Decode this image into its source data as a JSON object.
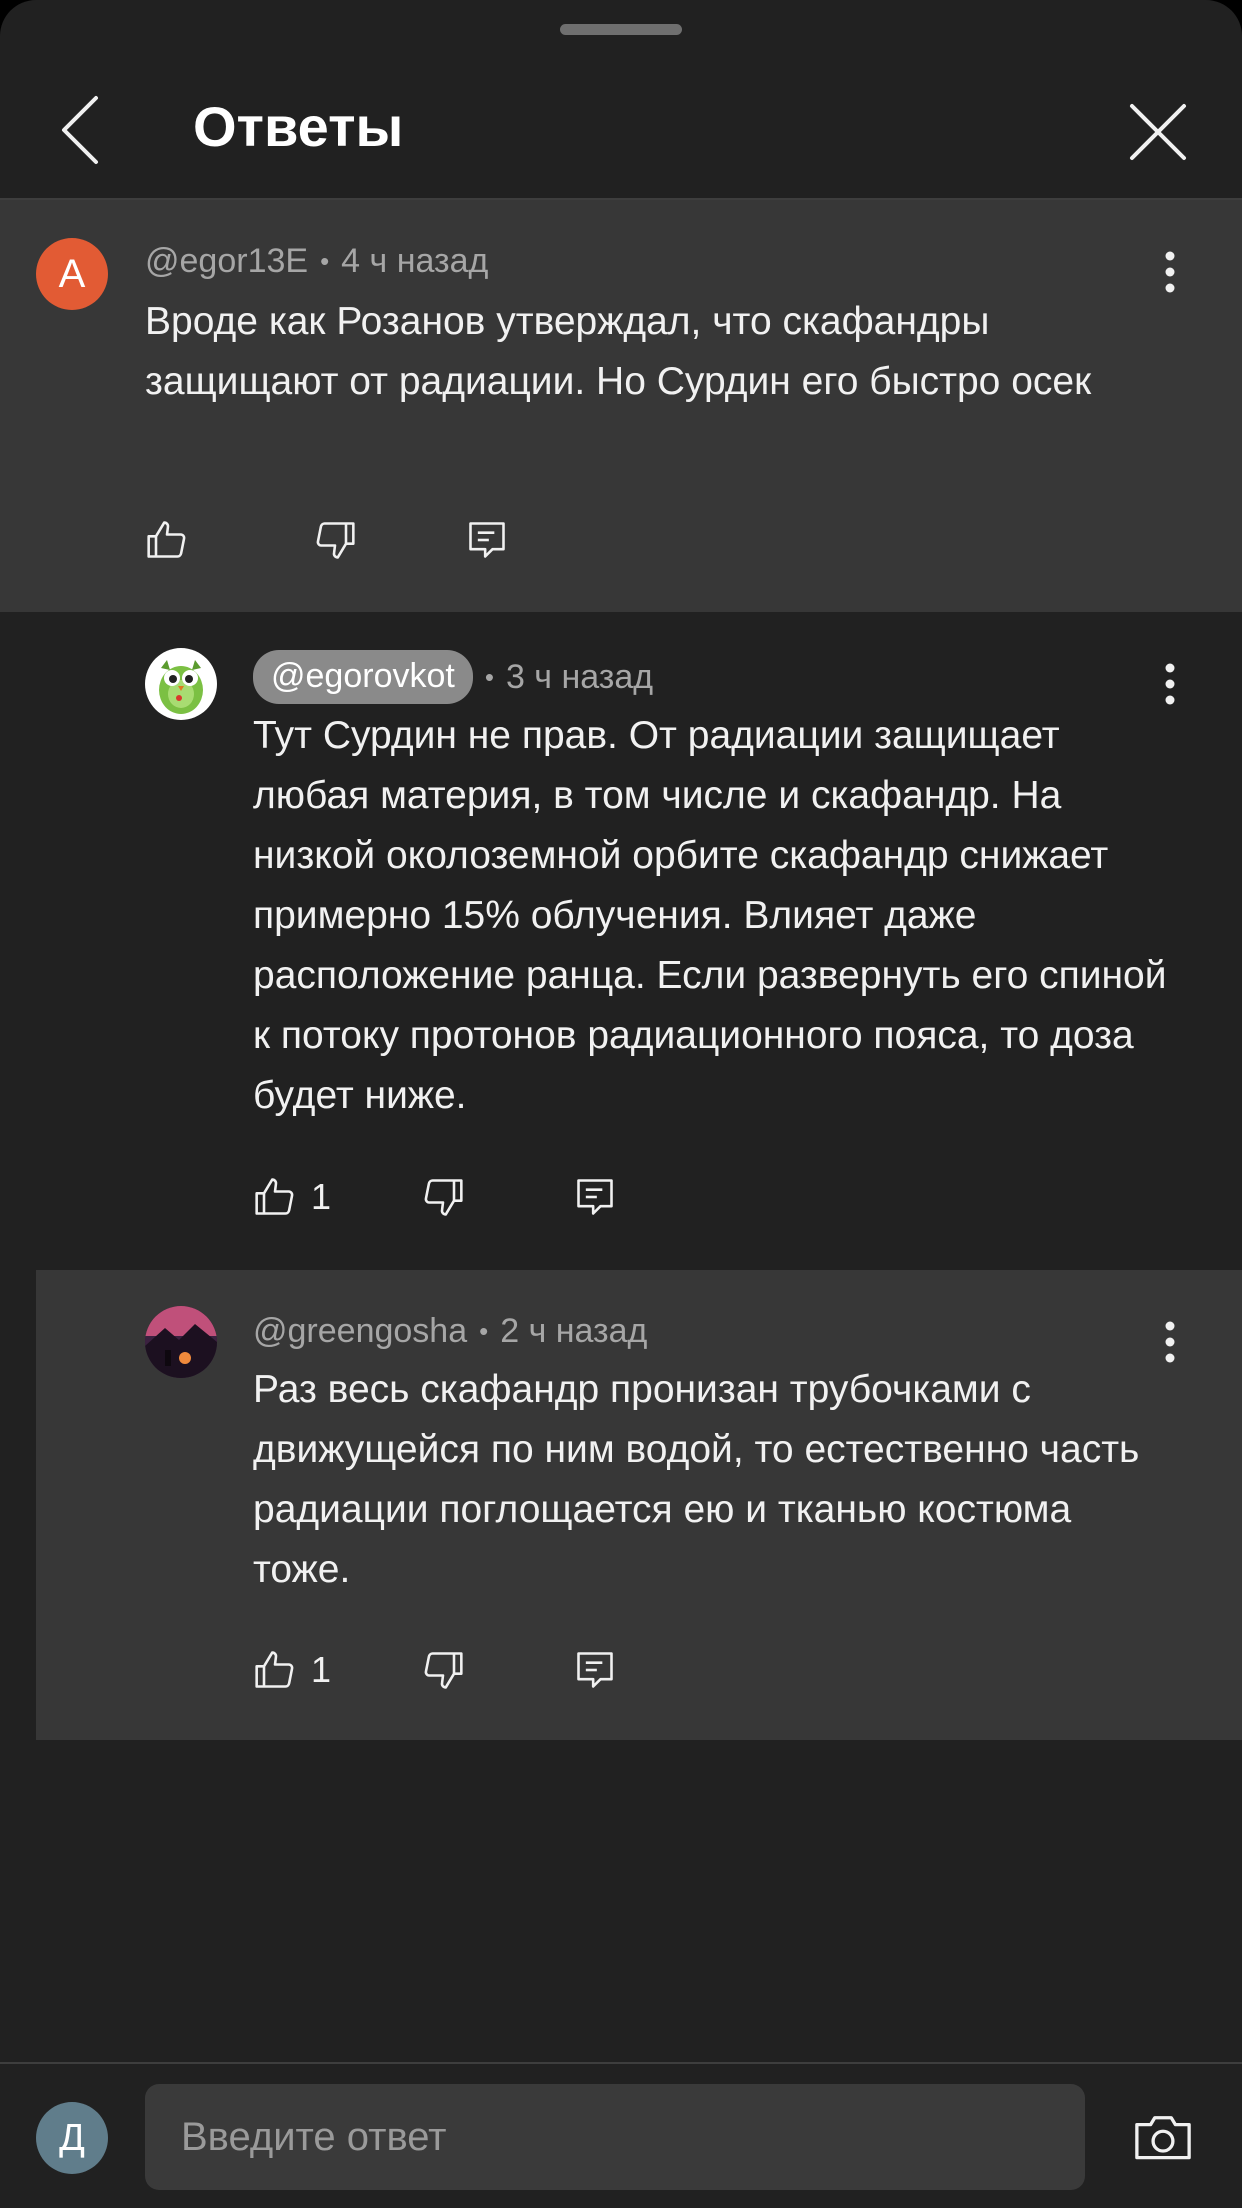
{
  "header": {
    "title": "Ответы"
  },
  "comments": [
    {
      "avatar_letter": "A",
      "avatar_color": "#e25b34",
      "author": "@egor13E",
      "time": "4 ч назад",
      "text": "Вроде как Розанов утверждал, что скафандры защищают от радиации. Но Сурдин его быстро осек",
      "likes": ""
    },
    {
      "avatar_icon": "green-owl-avatar-icon",
      "author": "@egorovkot",
      "time": "3 ч назад",
      "text": "Тут Сурдин не прав. От радиации защищает любая материя, в том числе и скафандр. На низкой околоземной орбите скафандр снижает примерно 15% облучения. Влияет даже расположение ранца. Если развернуть его спиной к потоку протонов радиационного пояса, то доза будет ниже.",
      "likes": "1"
    },
    {
      "avatar_icon": "landscape-photo-avatar-icon",
      "author": "@greengosha",
      "time": "2 ч назад",
      "text": "Раз весь скафандр пронизан трубочками с движущейся по ним водой, то естественно часть радиации поглощается ею и тканью костюма тоже.",
      "likes": "1"
    }
  ],
  "meta_separator": "•",
  "composer": {
    "avatar_letter": "Д",
    "placeholder": "Введите ответ"
  },
  "colors": {
    "background": "#212121",
    "highlight": "#373737",
    "chip": "#8a8a8a"
  }
}
